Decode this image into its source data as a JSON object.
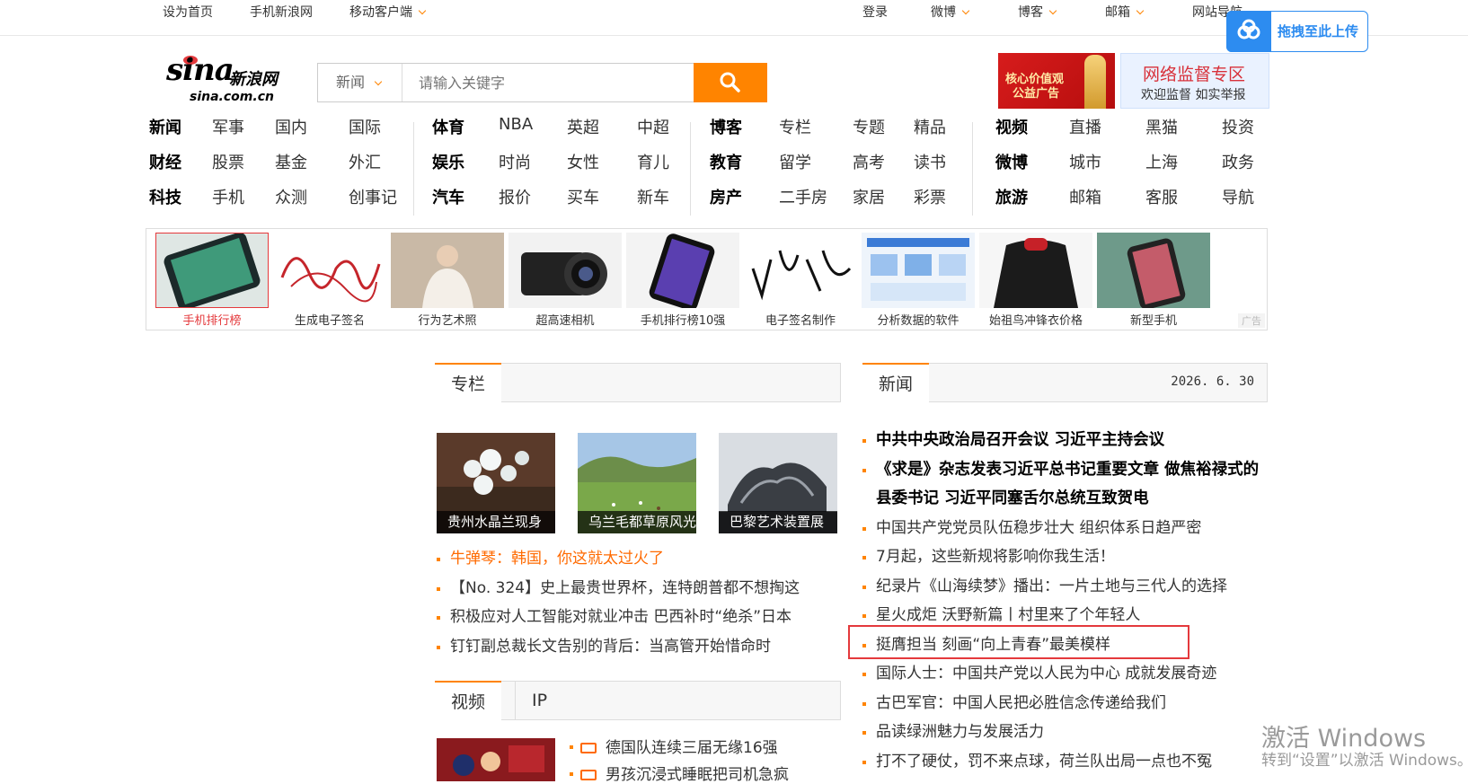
{
  "topbar": {
    "set_home": "设为首页",
    "mobile_sina": "手机新浪网",
    "mobile_client": "移动客户端",
    "login": "登录",
    "weibo": "微博",
    "blog": "博客",
    "mail": "邮箱",
    "site_nav": "网站导航"
  },
  "upload_widget": {
    "label": "拖拽至此上传"
  },
  "logo": {
    "brand": "sina",
    "brand_cn": "新浪网",
    "domain": "sina.com.cn"
  },
  "search": {
    "category": "新闻",
    "placeholder": "请输入关键字"
  },
  "ads_top": {
    "red_line1": "核心价值观",
    "red_line2": "公益广告",
    "blue_title": "网络监督专区",
    "blue_sub": "欢迎监督 如实举报"
  },
  "nav": {
    "rows": [
      [
        "新闻",
        "军事",
        "国内",
        "国际",
        "体育",
        "NBA",
        "英超",
        "中超",
        "博客",
        "专栏",
        "专题",
        "精品",
        "视频",
        "直播",
        "黑猫",
        "投资"
      ],
      [
        "财经",
        "股票",
        "基金",
        "外汇",
        "娱乐",
        "时尚",
        "女性",
        "育儿",
        "教育",
        "留学",
        "高考",
        "读书",
        "微博",
        "城市",
        "上海",
        "政务"
      ],
      [
        "科技",
        "手机",
        "众测",
        "创事记",
        "汽车",
        "报价",
        "买车",
        "新车",
        "房产",
        "二手房",
        "家居",
        "彩票",
        "旅游",
        "邮箱",
        "客服",
        "导航"
      ]
    ]
  },
  "ad_strip": {
    "items": [
      "手机排行榜",
      "生成电子签名",
      "行为艺术照",
      "超高速相机",
      "手机排行榜10强",
      "电子签名制作",
      "分析数据的软件",
      "始祖鸟冲锋衣价格",
      "新型手机"
    ],
    "ad_label": "广告"
  },
  "column": {
    "tab": "专栏",
    "photos": [
      "贵州水晶兰现身",
      "乌兰毛都草原风光",
      "巴黎艺术装置展"
    ],
    "headlines": [
      "牛弹琴：韩国，你这就太过火了",
      "【No. 324】史上最贵世界杯，连特朗普都不想掏这",
      "积极应对人工智能对就业冲击 巴西补时“绝杀”日本",
      "钉钉副总裁长文告别的背后：当高管开始惜命时"
    ]
  },
  "video": {
    "tab": "视频",
    "tab2": "IP",
    "items": [
      "德国队连续三届无缘16强",
      "男孩沉浸式睡眠把司机急疯"
    ]
  },
  "news": {
    "tab": "新闻",
    "date": "2026. 6. 30",
    "items": [
      "中共中央政治局召开会议 习近平主持会议",
      "《求是》杂志发表习近平总书记重要文章 做焦裕禄式的县委书记 习近平同塞舌尔总统互致贺电",
      "中国共产党党员队伍稳步壮大 组织体系日趋严密",
      "7月起，这些新规将影响你我生活！",
      "纪录片《山海续梦》播出：一片土地与三代人的选择",
      "星火成炬 沃野新篇丨村里来了个年轻人",
      "挺膺担当 刻画“向上青春”最美模样",
      "国际人士：中国共产党以人民为中心 成就发展奇迹",
      "古巴军官：中国人民把必胜信念传递给我们",
      "品读绿洲魅力与发展活力",
      "打不了硬仗，罚不来点球，荷兰队出局一点也不冤"
    ]
  },
  "watermark": {
    "line1": "激活 Windows",
    "line2": "转到“设置”以激活 Windows。"
  },
  "colors": {
    "accent": "#ff8400",
    "highlight": "#e4393c",
    "upload_blue": "#2d8cf0"
  }
}
